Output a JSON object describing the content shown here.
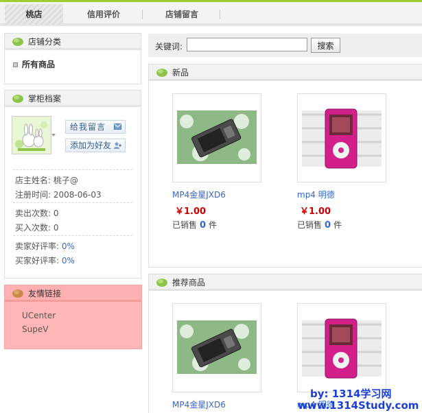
{
  "nav": {
    "tabs": [
      {
        "label": "桃店",
        "active": true
      },
      {
        "label": "信用评价",
        "active": false
      },
      {
        "label": "店铺留言",
        "active": false
      }
    ]
  },
  "sidebar": {
    "category": {
      "title": "店铺分类",
      "items": [
        {
          "label": "所有商品"
        }
      ]
    },
    "profile": {
      "title": "掌柜档案",
      "message_button": "给我留言",
      "add_friend_button": "添加为好友",
      "owner_label": "店主姓名:",
      "owner": "桃子@",
      "register_label": "注册时间:",
      "register_date": "2008-06-03",
      "sold_label": "卖出次数:",
      "sold": "0",
      "bought_label": "买入次数:",
      "bought": "0",
      "seller_rate_label": "卖家好评率:",
      "seller_rate": "0%",
      "buyer_rate_label": "买家好评率:",
      "buyer_rate": "0%"
    },
    "links": {
      "title": "友情链接",
      "items": [
        {
          "label": "UCenter"
        },
        {
          "label": "SupeV"
        }
      ]
    }
  },
  "search": {
    "label": "关键词:",
    "value": "",
    "button": "搜索"
  },
  "sections": {
    "new": {
      "title": "新品",
      "products": [
        {
          "name": "MP4金星JXD6",
          "price": "￥1.00",
          "sold_label": "已销售",
          "sold": "0",
          "unit": "件"
        },
        {
          "name": "mp4 明德",
          "price": "￥1.00",
          "sold_label": "已销售",
          "sold": "0",
          "unit": "件"
        }
      ]
    },
    "recommended": {
      "title": "推荐商品",
      "products": [
        {
          "name": "MP4金星JXD6"
        },
        {
          "name": "mp4 明德"
        }
      ]
    }
  },
  "watermark": {
    "line1": "by: 1314学习网",
    "line2": "www.1314Study.com"
  },
  "colors": {
    "accent": "#9acd32",
    "link": "#3366cc",
    "price": "#cc0000",
    "links_panel": "#ffb6b6"
  }
}
